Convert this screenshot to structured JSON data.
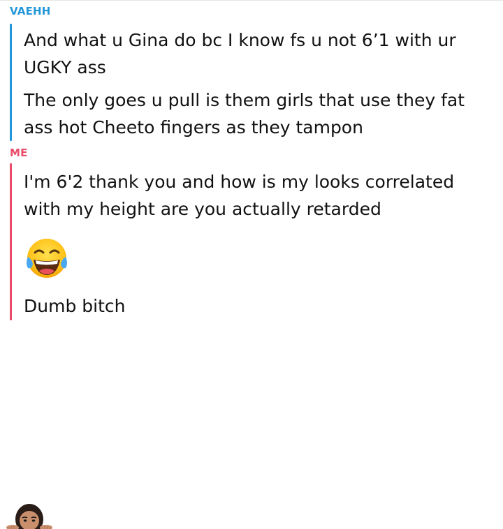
{
  "conversation": {
    "them": {
      "name": "VAEHH",
      "messages": [
        "And what u Gina do bc I know fs u not 6’1 with ur UGKY ass",
        "The only goes u pull is them girls that use they fat ass hot Cheeto fingers as they tampon"
      ]
    },
    "me": {
      "name": "ME",
      "messages": [
        "I'm 6'2 thank you and how is my looks correlated with my height are you actually retarded",
        "Dumb bitch"
      ],
      "emoji": "face-with-tears-of-joy"
    }
  },
  "colors": {
    "them_accent": "#2196d9",
    "me_accent": "#e94b68"
  },
  "footer": {
    "avatar": "bitmoji-peeking-avatar"
  }
}
